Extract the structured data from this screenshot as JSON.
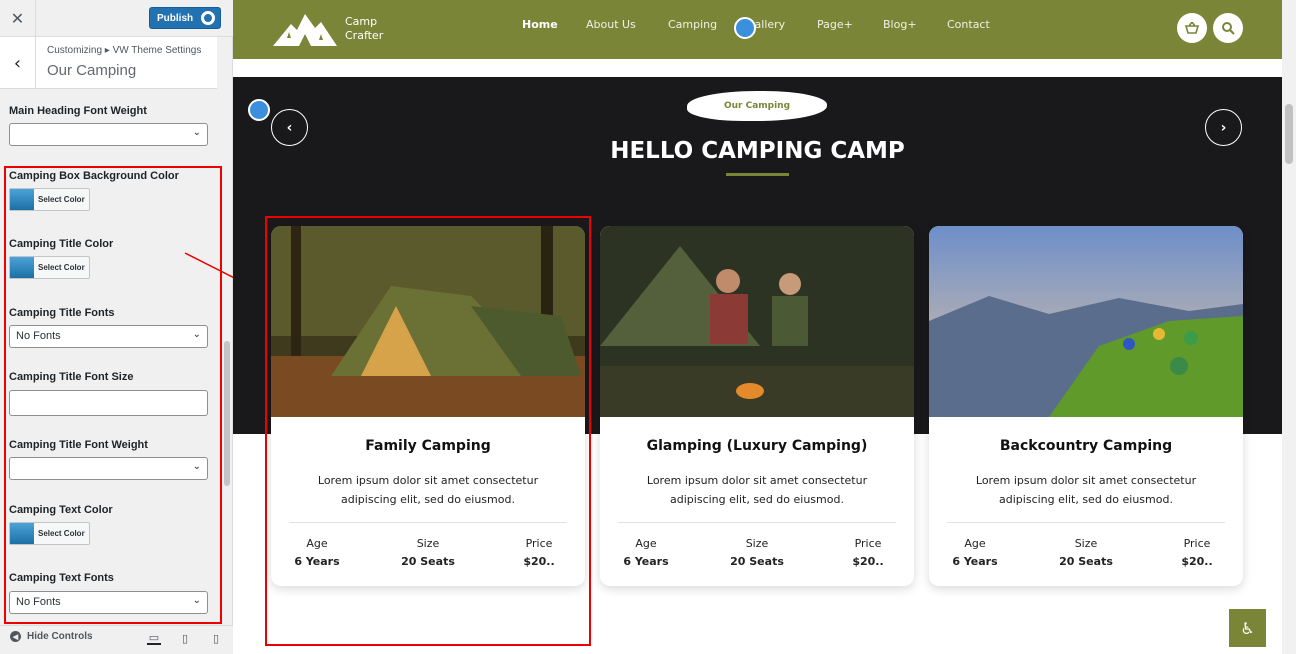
{
  "customizer": {
    "publish_label": "Publish",
    "breadcrumb": "Customizing ▸ VW Theme Settings",
    "section_title": "Our Camping",
    "controls": {
      "main_heading_font_weight": {
        "label": "Main Heading Font Weight",
        "value": ""
      },
      "camping_box_bg_color": {
        "label": "Camping Box Background Color",
        "button": "Select Color"
      },
      "camping_title_color": {
        "label": "Camping Title Color",
        "button": "Select Color"
      },
      "camping_title_fonts": {
        "label": "Camping Title Fonts",
        "value": "No Fonts"
      },
      "camping_title_font_size": {
        "label": "Camping Title Font Size",
        "value": ""
      },
      "camping_title_font_weight": {
        "label": "Camping Title Font Weight",
        "value": ""
      },
      "camping_text_color": {
        "label": "Camping Text Color",
        "button": "Select Color"
      },
      "camping_text_fonts": {
        "label": "Camping Text Fonts",
        "value": "No Fonts"
      }
    },
    "footer": {
      "hide_controls": "Hide Controls"
    }
  },
  "site": {
    "logo_line1": "Camp",
    "logo_line2": "Crafter",
    "menu": [
      "Home",
      "About Us",
      "Camping",
      "Gallery",
      "Page+",
      "Blog+",
      "Contact"
    ],
    "active_menu": "Home",
    "section_tag": "Our Camping",
    "section_heading": "HELLO CAMPING CAMP",
    "cards": [
      {
        "title": "Family Camping",
        "desc": "Lorem ipsum dolor sit amet consectetur adipiscing elit, sed do eiusmod.",
        "age_label": "Age",
        "age": "6 Years",
        "size_label": "Size",
        "size": "20 Seats",
        "price_label": "Price",
        "price": "$20.."
      },
      {
        "title": "Glamping (Luxury Camping)",
        "desc": "Lorem ipsum dolor sit amet consectetur adipiscing elit, sed do eiusmod.",
        "age_label": "Age",
        "age": "6 Years",
        "size_label": "Size",
        "size": "20 Seats",
        "price_label": "Price",
        "price": "$20.."
      },
      {
        "title": "Backcountry Camping",
        "desc": "Lorem ipsum dolor sit amet consectetur adipiscing elit, sed do eiusmod.",
        "age_label": "Age",
        "age": "6 Years",
        "size_label": "Size",
        "size": "20 Seats",
        "price_label": "Price",
        "price": "$20.."
      }
    ]
  },
  "colors": {
    "brand_olive": "#7b8538",
    "hero_dark": "#19191c",
    "wp_blue": "#2271b1",
    "annotation_red": "#e00000"
  },
  "icons": [
    "close-icon",
    "gear-icon",
    "chevron-left-icon",
    "chevron-down-icon",
    "desktop-icon",
    "tablet-icon",
    "mobile-icon",
    "basket-icon",
    "search-icon",
    "pencil-icon",
    "chevron-right-icon",
    "accessibility-icon"
  ]
}
